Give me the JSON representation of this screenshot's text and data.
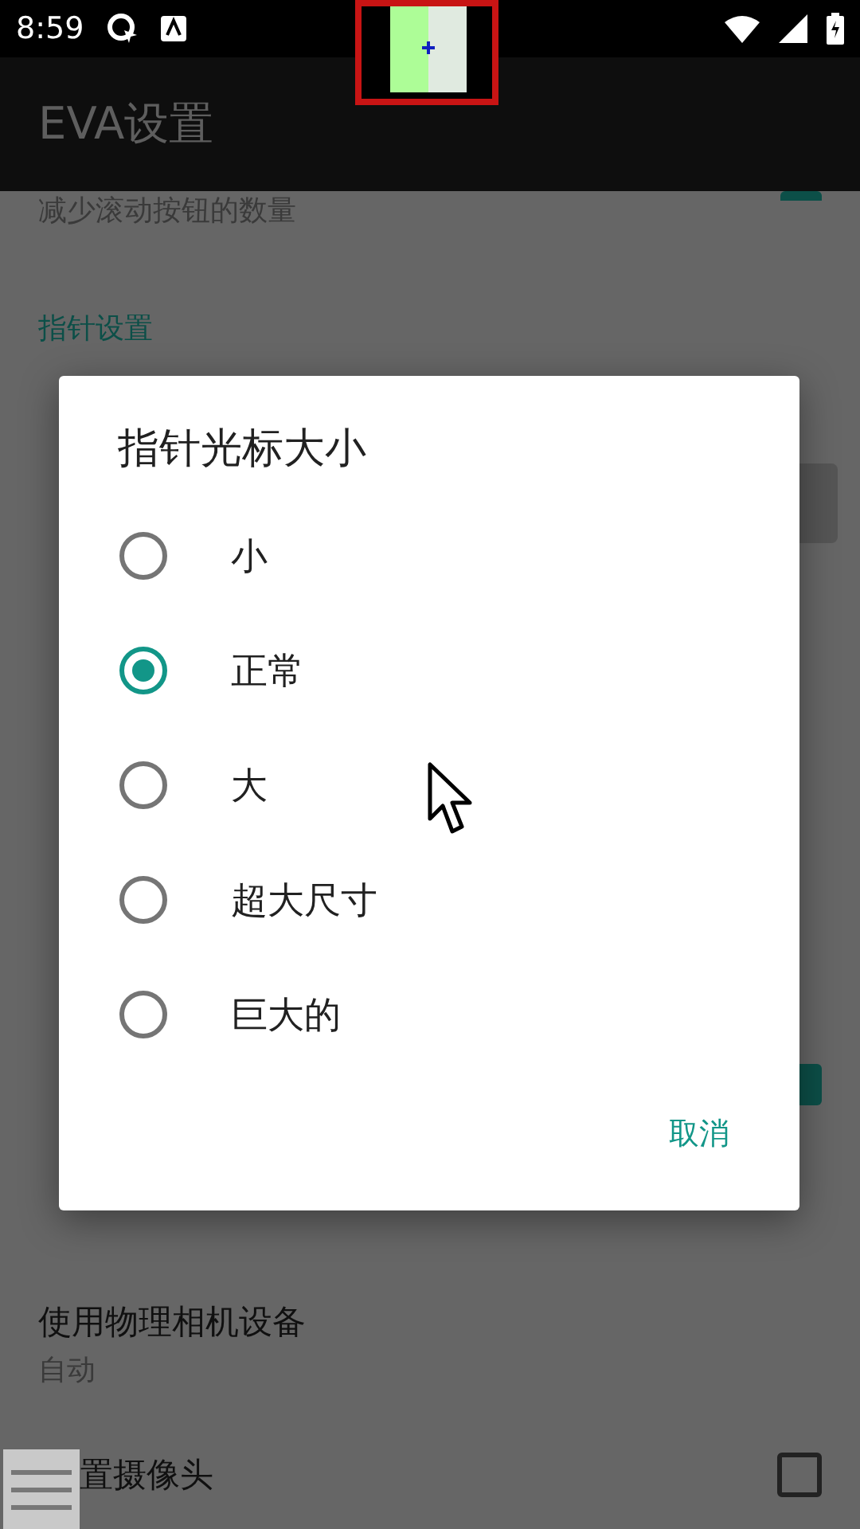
{
  "status_bar": {
    "time": "8:59"
  },
  "app_bar": {
    "title": "EVA设置"
  },
  "settings": [
    {
      "kind": "partial_switch",
      "summary": "减少滚动按钮的数量",
      "checked": true
    },
    {
      "kind": "header",
      "title": "指针设置"
    },
    {
      "kind": "covered_preview"
    },
    {
      "kind": "covered"
    },
    {
      "kind": "covered_header"
    },
    {
      "kind": "covered"
    },
    {
      "kind": "covered_switch",
      "checked": true
    },
    {
      "kind": "covered_header"
    },
    {
      "kind": "row",
      "title": "使用物理相机设备",
      "summary": "自动"
    },
    {
      "kind": "checkbox_row",
      "title": "置摄像头",
      "checked": false
    }
  ],
  "dialog": {
    "title": "指针光标大小",
    "options": [
      {
        "label": "小",
        "selected": false
      },
      {
        "label": "正常",
        "selected": true
      },
      {
        "label": "大",
        "selected": false
      },
      {
        "label": "超大尺寸",
        "selected": false
      },
      {
        "label": "巨大的",
        "selected": false
      }
    ],
    "cancel": "取消"
  }
}
